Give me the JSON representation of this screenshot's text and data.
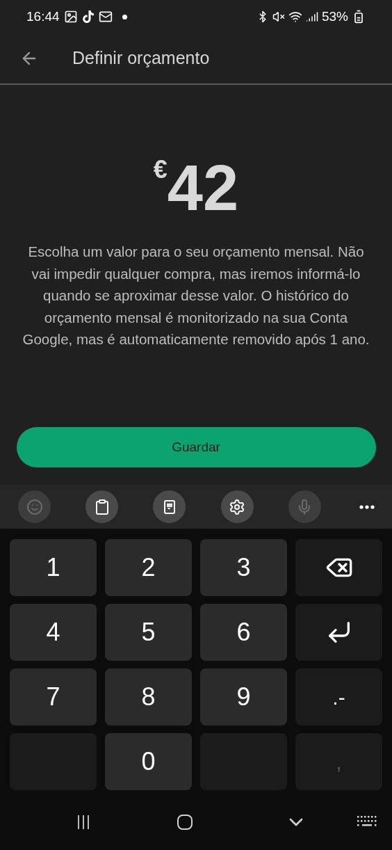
{
  "status_bar": {
    "time": "16:44",
    "battery": "53%"
  },
  "header": {
    "title": "Definir orçamento"
  },
  "budget": {
    "currency": "€",
    "amount": "42",
    "description": "Escolha um valor para o seu orçamento mensal. Não vai impedir qualquer compra, mas iremos informá-lo quando se aproximar desse valor. O histórico do orçamento mensal é monitorizado na sua Conta Google, mas é automaticamente removido após 1 ano."
  },
  "save_button": {
    "label": "Guardar"
  },
  "keyboard_toolbar": [
    {
      "kind": "emoji",
      "disabled": true
    },
    {
      "kind": "clipboard",
      "disabled": false
    },
    {
      "kind": "keypad",
      "disabled": false
    },
    {
      "kind": "settings",
      "disabled": false
    },
    {
      "kind": "voice",
      "disabled": true
    },
    {
      "kind": "more",
      "disabled": false
    }
  ],
  "keys": [
    {
      "kind": "digit",
      "label": "1"
    },
    {
      "kind": "digit",
      "label": "2"
    },
    {
      "kind": "digit",
      "label": "3"
    },
    {
      "kind": "backspace"
    },
    {
      "kind": "digit",
      "label": "4"
    },
    {
      "kind": "digit",
      "label": "5"
    },
    {
      "kind": "digit",
      "label": "6"
    },
    {
      "kind": "enter"
    },
    {
      "kind": "digit",
      "label": "7"
    },
    {
      "kind": "digit",
      "label": "8"
    },
    {
      "kind": "digit",
      "label": "9"
    },
    {
      "kind": "symbol",
      "label": ".-"
    },
    {
      "kind": "blank"
    },
    {
      "kind": "digit",
      "label": "0"
    },
    {
      "kind": "blank"
    },
    {
      "kind": "symbol",
      "label": ",",
      "disabled": true
    }
  ]
}
